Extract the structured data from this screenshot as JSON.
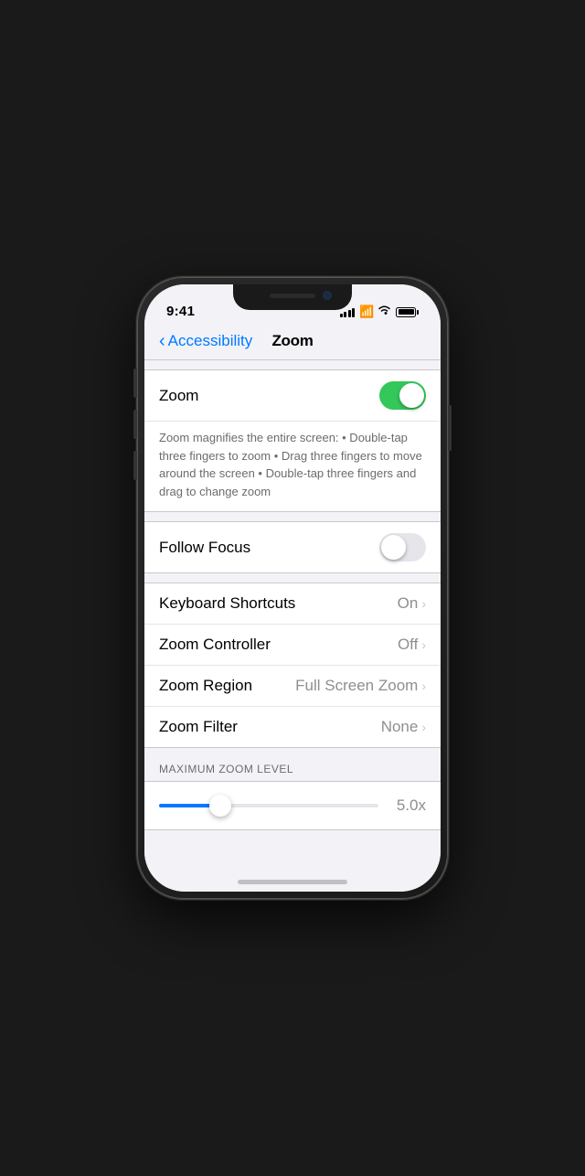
{
  "statusBar": {
    "time": "9:41",
    "signalBars": 4,
    "wifiLabel": "WiFi",
    "batteryLabel": "Battery"
  },
  "navBar": {
    "backLabel": "Accessibility",
    "title": "Zoom"
  },
  "zoomSection": {
    "label": "Zoom",
    "toggleState": "on",
    "description": "Zoom magnifies the entire screen:\n• Double-tap three fingers to zoom\n• Drag three fingers to move around the screen\n• Double-tap three fingers and drag to change zoom"
  },
  "followFocusSection": {
    "label": "Follow Focus",
    "toggleState": "off"
  },
  "settingsRows": [
    {
      "label": "Keyboard Shortcuts",
      "value": "On"
    },
    {
      "label": "Zoom Controller",
      "value": "Off"
    },
    {
      "label": "Zoom Region",
      "value": "Full Screen Zoom"
    },
    {
      "label": "Zoom Filter",
      "value": "None"
    }
  ],
  "sliderSection": {
    "header": "MAXIMUM ZOOM LEVEL",
    "value": "5.0x",
    "fillPercent": 28
  }
}
